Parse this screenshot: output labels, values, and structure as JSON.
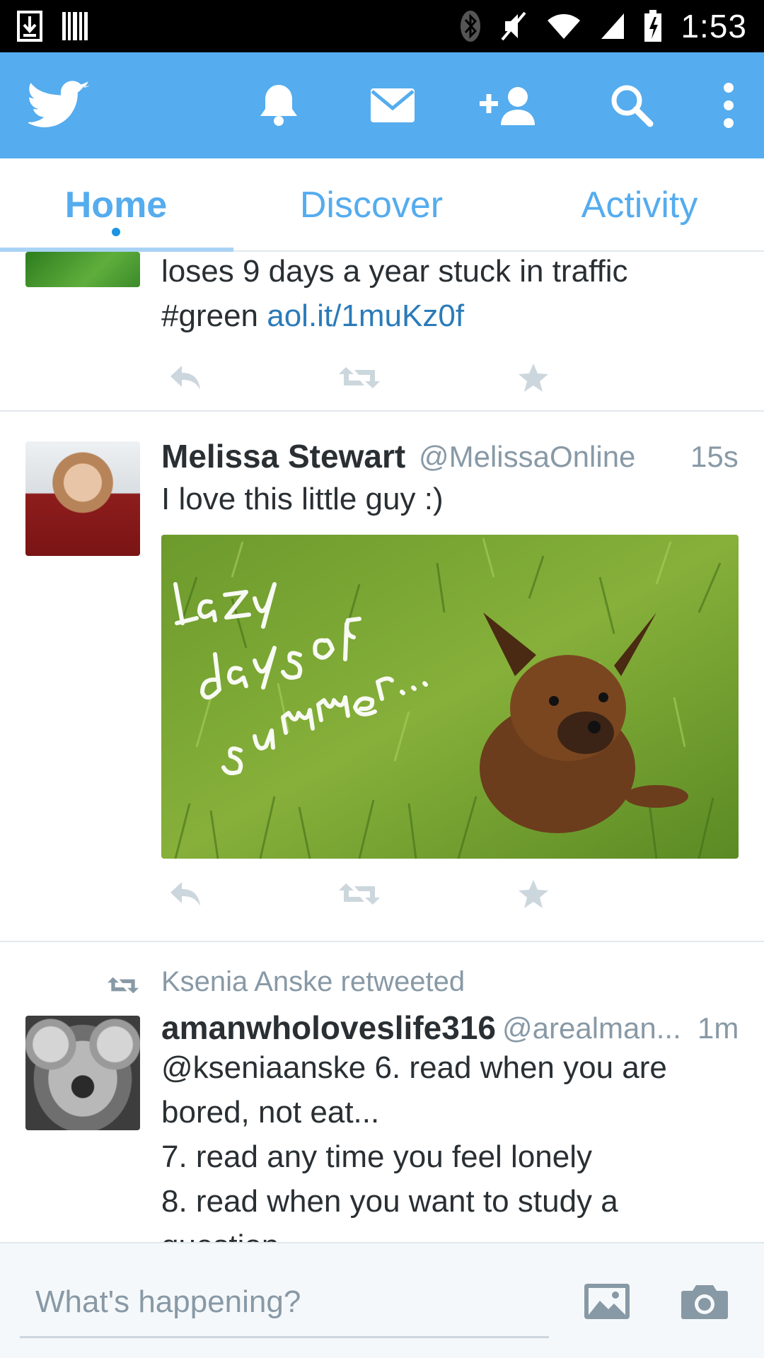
{
  "status_bar": {
    "time": "1:53",
    "icons": [
      "download-icon",
      "barcode-icon",
      "bluetooth-icon",
      "mute-icon",
      "wifi-icon",
      "signal-icon",
      "battery-icon"
    ]
  },
  "action_bar": {
    "color": "#55acee",
    "icons": [
      "twitter-bird-icon",
      "bell-icon",
      "mail-icon",
      "add-user-icon",
      "search-icon",
      "overflow-menu-icon"
    ]
  },
  "tabs": [
    {
      "label": "Home",
      "active": true
    },
    {
      "label": "Discover",
      "active": false
    },
    {
      "label": "Activity",
      "active": false
    }
  ],
  "timeline": {
    "tweet_partial": {
      "line1": "loses 9 days a year stuck in traffic",
      "line2_text": "#green ",
      "line2_link": "aol.it/1muKz0f"
    },
    "tweet_main": {
      "name": "Melissa Stewart",
      "handle": "@MelissaOnline",
      "time": "15s",
      "text": "I love this little guy :)",
      "photo_caption_lines": [
        "Lazy",
        "days of",
        "summer..."
      ]
    },
    "tweet_retweet": {
      "retweeted_by": "Ksenia Anske retweeted",
      "name": "amanwholoveslife316",
      "handle": "@arealman...",
      "time": "1m",
      "lines": [
        "@kseniaanske 6. read when you are",
        "bored, not eat...",
        "7. read any time you feel lonely",
        "8. read when you want to study a",
        "question"
      ]
    }
  },
  "compose": {
    "placeholder": "What's happening?",
    "icons": [
      "image-icon",
      "camera-icon"
    ]
  },
  "colors": {
    "brand": "#55acee",
    "link": "#2b7bb9",
    "muted": "#8899a6",
    "text": "#292f33"
  }
}
